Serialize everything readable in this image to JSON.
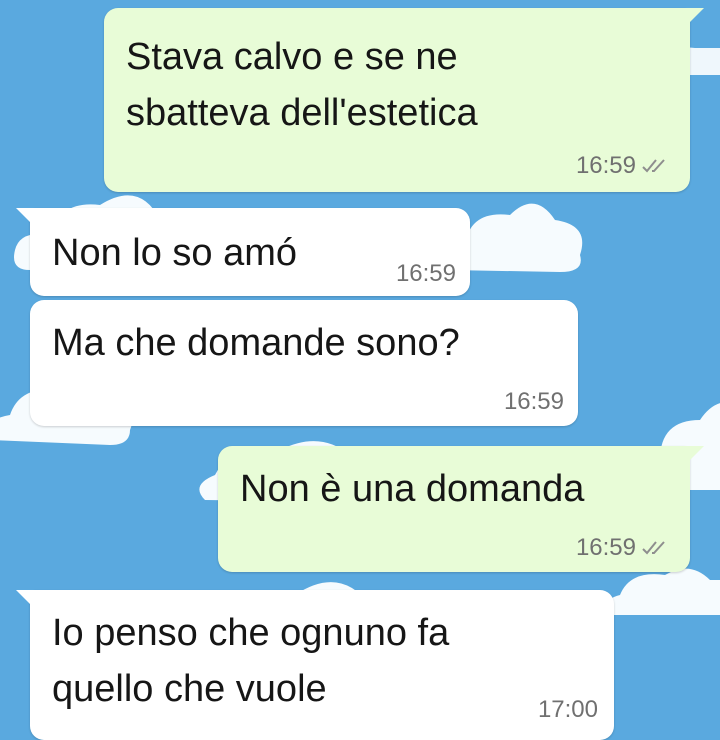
{
  "colors": {
    "wallpaper": "#5aa9df",
    "outgoing_bubble": "#e8fcd7",
    "incoming_bubble": "#ffffff",
    "cloud": "#ffffff",
    "timestamp": "#707070",
    "read_receipt": "#8e8e8e"
  },
  "icons": {
    "read_receipt": "double-check-icon",
    "wallpaper_shape": "cloud-icon"
  },
  "messages": [
    {
      "direction": "outgoing",
      "lines": [
        "Stava calvo e se ne",
        "sbatteva dell'estetica"
      ],
      "time": "16:59",
      "read_receipt": true
    },
    {
      "direction": "incoming",
      "lines": [
        "Non lo so amó"
      ],
      "time": "16:59"
    },
    {
      "direction": "incoming",
      "lines": [
        "Ma che domande sono?"
      ],
      "time": "16:59"
    },
    {
      "direction": "outgoing",
      "lines": [
        "Non è una domanda"
      ],
      "time": "16:59",
      "read_receipt": true
    },
    {
      "direction": "incoming",
      "lines": [
        "Io penso che ognuno fa",
        "quello che vuole"
      ],
      "time": "17:00"
    }
  ]
}
